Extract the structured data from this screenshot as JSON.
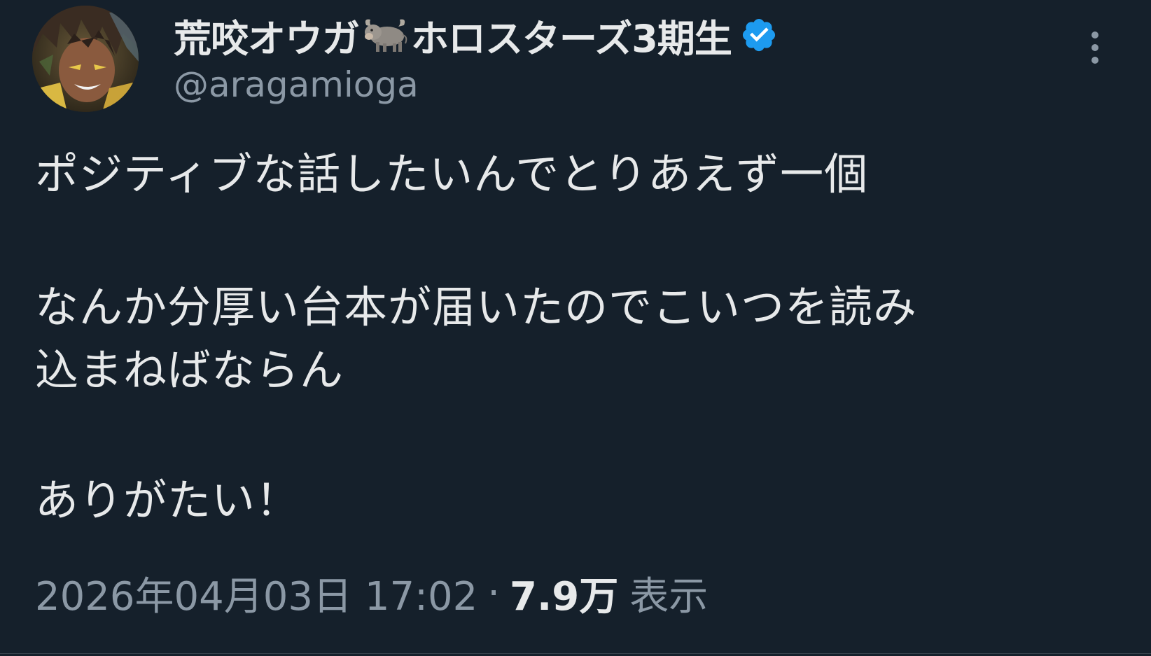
{
  "author": {
    "display_name": "荒咬オウガ",
    "display_name_suffix": "ホロスターズ3期生",
    "name_emoji": "ox-emoji",
    "handle": "@aragamioga",
    "verified": true,
    "verified_color": "#1d9bf0"
  },
  "tweet": {
    "lines": [
      "ポジティブな話したいんでとりあえず一個",
      "なんか分厚い台本が届いたのでこいつを読み",
      "込まねばならん",
      "ありがたい！"
    ],
    "timestamp": "2026年04月03日 17:02",
    "separator": "·",
    "views_count": "7.9万",
    "views_label": "表示"
  },
  "icons": {
    "more": "more-vertical-icon",
    "verified": "verified-badge-icon"
  },
  "colors": {
    "background": "#15202b",
    "text": "#e7e9ea",
    "secondary": "#8b98a5"
  }
}
